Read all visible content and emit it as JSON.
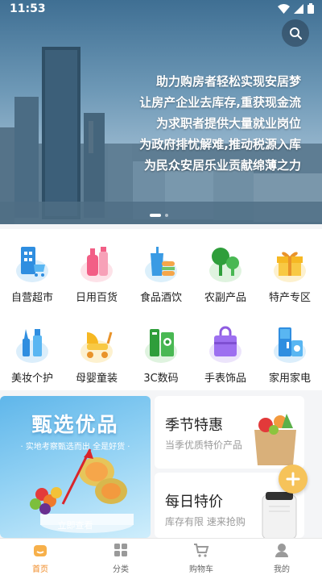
{
  "status_bar": {
    "time": "11:53"
  },
  "banner": {
    "lines": [
      "助力购房者轻松实现安居梦",
      "让房产企业去库存,重获现金流",
      "为求职者提供大量就业岗位",
      "为政府排忧解难,推动税源入库",
      "为民众安居乐业贡献绵薄之力"
    ],
    "active_slide": 1
  },
  "categories": [
    {
      "label": "自营超市",
      "icon": "supermarket-icon"
    },
    {
      "label": "日用百货",
      "icon": "daily-goods-icon"
    },
    {
      "label": "食品酒饮",
      "icon": "food-drinks-icon"
    },
    {
      "label": "农副产品",
      "icon": "farm-products-icon"
    },
    {
      "label": "特产专区",
      "icon": "gift-icon"
    },
    {
      "label": "美妆个护",
      "icon": "cosmetics-icon"
    },
    {
      "label": "母婴童装",
      "icon": "baby-stroller-icon"
    },
    {
      "label": "3C数码",
      "icon": "digital-icon"
    },
    {
      "label": "手表饰品",
      "icon": "bag-icon"
    },
    {
      "label": "家用家电",
      "icon": "appliance-icon"
    }
  ],
  "promo": {
    "featured": {
      "title": "甄选优品",
      "subtitle": "· 实地考察甄选而出 全是好货 ·",
      "cta": "立即查看"
    },
    "seasonal": {
      "title": "季节特惠",
      "subtitle": "当季优质特价产品"
    },
    "daily": {
      "title": "每日特价",
      "subtitle": "库存有限 速来抢购"
    }
  },
  "tabs": [
    {
      "label": "首页",
      "icon": "home-icon",
      "active": true
    },
    {
      "label": "分类",
      "icon": "category-icon",
      "active": false
    },
    {
      "label": "购物车",
      "icon": "cart-icon",
      "active": false
    },
    {
      "label": "我的",
      "icon": "user-icon",
      "active": false
    }
  ],
  "colors": {
    "accent": "#f08a24",
    "fab": "#f6c35a",
    "banner_text": "#ffffff"
  }
}
